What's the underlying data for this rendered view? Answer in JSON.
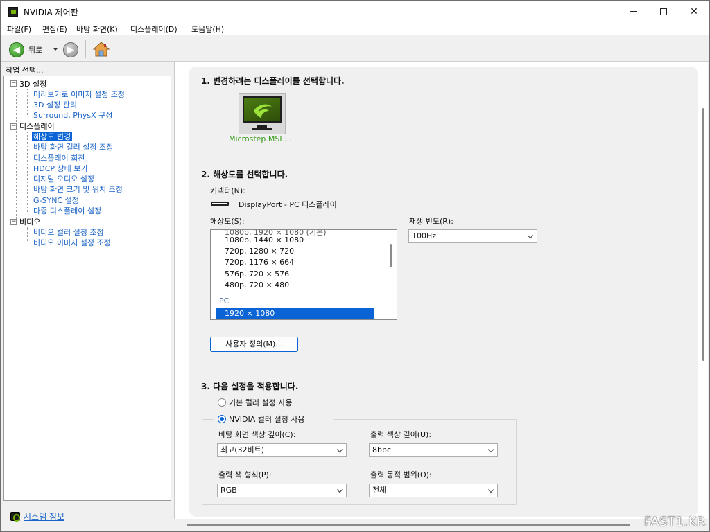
{
  "window": {
    "title": "NVIDIA 제어판"
  },
  "menu": [
    "파일(F)",
    "편집(E)",
    "바탕 화면(K)",
    "디스플레이(D)",
    "도움말(H)"
  ],
  "toolbar": {
    "back_label": "뒤로"
  },
  "left_pane": {
    "task_label": "작업 선택...",
    "tree": [
      {
        "label": "3D 설정",
        "kind": "group"
      },
      {
        "label": "미리보기로 이미지 설정 조정",
        "kind": "link"
      },
      {
        "label": "3D 설정 관리",
        "kind": "link"
      },
      {
        "label": "Surround, PhysX 구성",
        "kind": "link"
      },
      {
        "label": "디스플레이",
        "kind": "group"
      },
      {
        "label": "해상도 변경",
        "kind": "link",
        "selected": true
      },
      {
        "label": "바탕 화면 컬러 설정 조정",
        "kind": "link"
      },
      {
        "label": "디스플레이 회전",
        "kind": "link"
      },
      {
        "label": "HDCP 상태 보기",
        "kind": "link"
      },
      {
        "label": "디지털 오디오 설정",
        "kind": "link"
      },
      {
        "label": "바탕 화면 크기 및 위치 조정",
        "kind": "link"
      },
      {
        "label": "G-SYNC 설정",
        "kind": "link"
      },
      {
        "label": "다중 디스플레이 설정",
        "kind": "link"
      },
      {
        "label": "비디오",
        "kind": "group"
      },
      {
        "label": "비디오 컬러 설정 조정",
        "kind": "link"
      },
      {
        "label": "비디오 이미지 설정 조정",
        "kind": "link"
      }
    ],
    "system_info": "시스템 정보"
  },
  "section1": {
    "heading": "1. 변경하려는 디스플레이를 선택합니다.",
    "display_name": "Microstep MSI ..."
  },
  "section2": {
    "heading": "2. 해상도를 선택합니다.",
    "connector_label": "커넥터(N):",
    "connector_value": "DisplayPort - PC 디스플레이",
    "resolution_label": "해상도(S):",
    "resolutions": [
      "1080p, 1440 × 1080",
      "720p, 1280 × 720",
      "720p, 1176 × 664",
      "576p, 720 × 576",
      "480p, 720 × 480"
    ],
    "pc_group_label": "PC",
    "selected_resolution": "1920 × 1080",
    "refresh_label": "재생 빈도(R):",
    "refresh_value": "100Hz",
    "custom_button": "사용자 정의(M)..."
  },
  "section3": {
    "heading": "3. 다음 설정을 적용합니다.",
    "radio_default": "기본 컬러 설정 사용",
    "radio_nvidia": "NVIDIA 컬러 설정 사용",
    "desktop_depth_label": "바탕 화면 색상 깊이(C):",
    "desktop_depth_value": "최고(32비트)",
    "output_depth_label": "출력 색상 깊이(U):",
    "output_depth_value": "8bpc",
    "output_format_label": "출력 색 형식(P):",
    "output_format_value": "RGB",
    "dynamic_range_label": "출력 동적 범위(O):",
    "dynamic_range_value": "전체"
  },
  "watermark": "FAST1.KR",
  "colors": {
    "accent": "#0a64d6",
    "link": "#1a63c6",
    "nvidia_green": "#76b900"
  }
}
